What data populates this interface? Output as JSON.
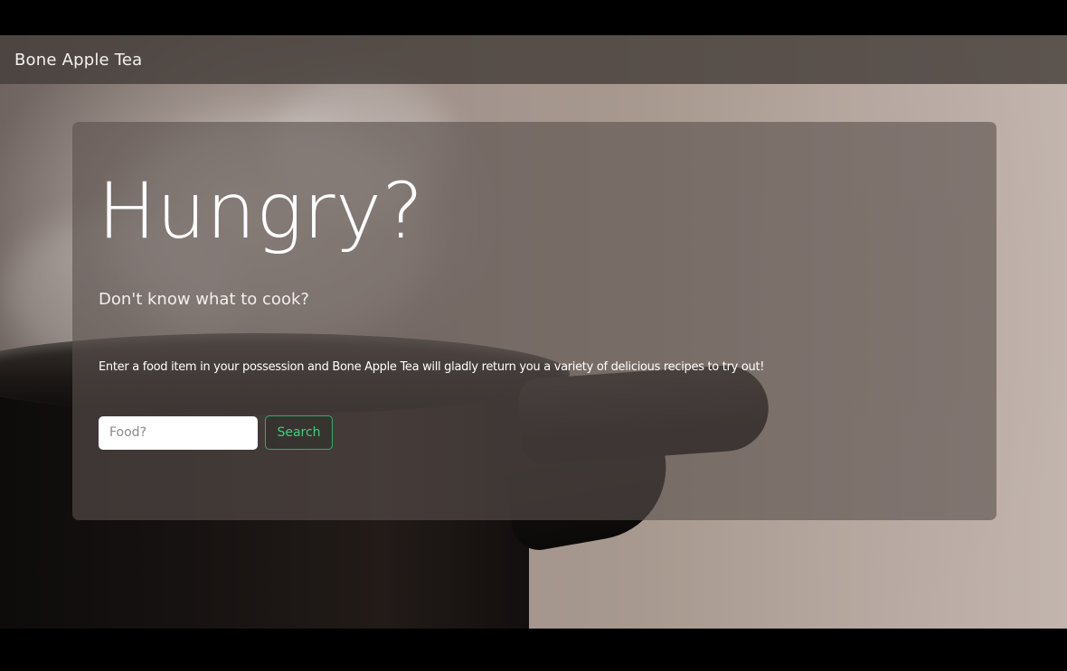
{
  "navbar": {
    "brand": "Bone Apple Tea"
  },
  "hero": {
    "headline": "Hungry?",
    "lead": "Don't know what to cook?",
    "description": "Enter a food item in your possession and Bone Apple Tea will gladly return you a variety of delicious recipes to try out!"
  },
  "search": {
    "placeholder": "Food?",
    "value": "",
    "button_label": "Search"
  },
  "colors": {
    "accent": "#2fae6a",
    "navbar": "#463e3b",
    "panel": "#5a504d"
  },
  "background_image": "steaming-pot-photo"
}
